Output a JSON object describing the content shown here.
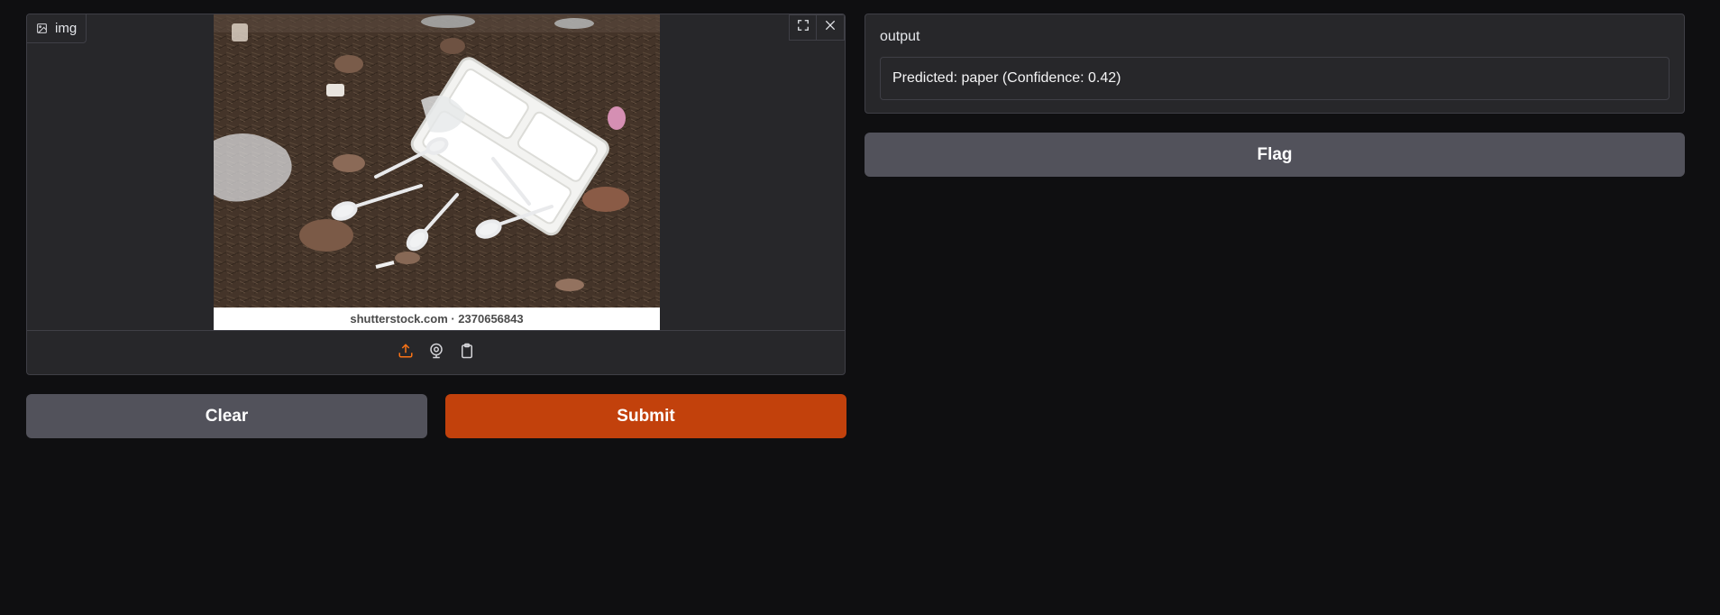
{
  "input": {
    "label": "img",
    "label_icon": "image-icon",
    "image_watermark": "shutterstock.com · 2370656843",
    "image_alt": "Plastic cutlery and styrofoam food tray litter on forest ground",
    "corner_actions": [
      "fullscreen-icon",
      "close-icon"
    ],
    "sources": [
      "upload-icon",
      "webcam-icon",
      "clipboard-icon"
    ]
  },
  "buttons": {
    "clear_label": "Clear",
    "submit_label": "Submit",
    "flag_label": "Flag"
  },
  "output": {
    "label": "output",
    "value": "Predicted: paper (Confidence: 0.42)"
  },
  "colors": {
    "background": "#0f0f11",
    "panel": "#27272a",
    "border": "#3f3f46",
    "primary": "#c2410c",
    "secondary": "#52525b",
    "accent_icon": "#f97316"
  }
}
